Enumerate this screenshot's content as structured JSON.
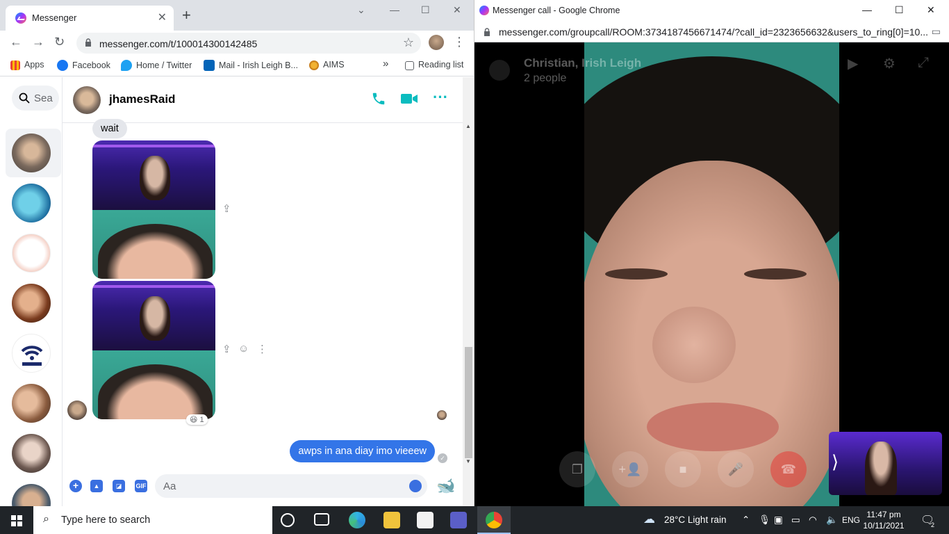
{
  "left_window": {
    "tab_title": "Messenger",
    "url": "messenger.com/t/100014300142485",
    "bookmarks": [
      "Apps",
      "Facebook",
      "Home / Twitter",
      "Mail - Irish Leigh B...",
      "AIMS",
      "Reading list"
    ],
    "bookmarks_more": "»",
    "search_placeholder": "Sea",
    "conversation": {
      "name": "jhamesRaid",
      "incoming_text": "wait",
      "reaction_count": "1",
      "outgoing_text": "awps in ana diay imo vieeew",
      "composer_placeholder": "Aa"
    },
    "compose_gif_label": "GIF"
  },
  "right_window": {
    "title": "Messenger call - Google Chrome",
    "url": "messenger.com/groupcall/ROOM:3734187456671474/?call_id=2323656632&users_to_ring[0]=10...",
    "call_name": "Christian, Irish Leigh",
    "call_count": "2 people"
  },
  "taskbar": {
    "search_placeholder": "Type here to search",
    "weather": "28°C  Light rain",
    "language": "ENG",
    "time": "11:47 pm",
    "date": "10/11/2021",
    "notifications": "2"
  },
  "colors": {
    "messenger_blue": "#3375e8",
    "header_icon_teal": "#0abcbf",
    "taskbar_bg": "#202428"
  }
}
